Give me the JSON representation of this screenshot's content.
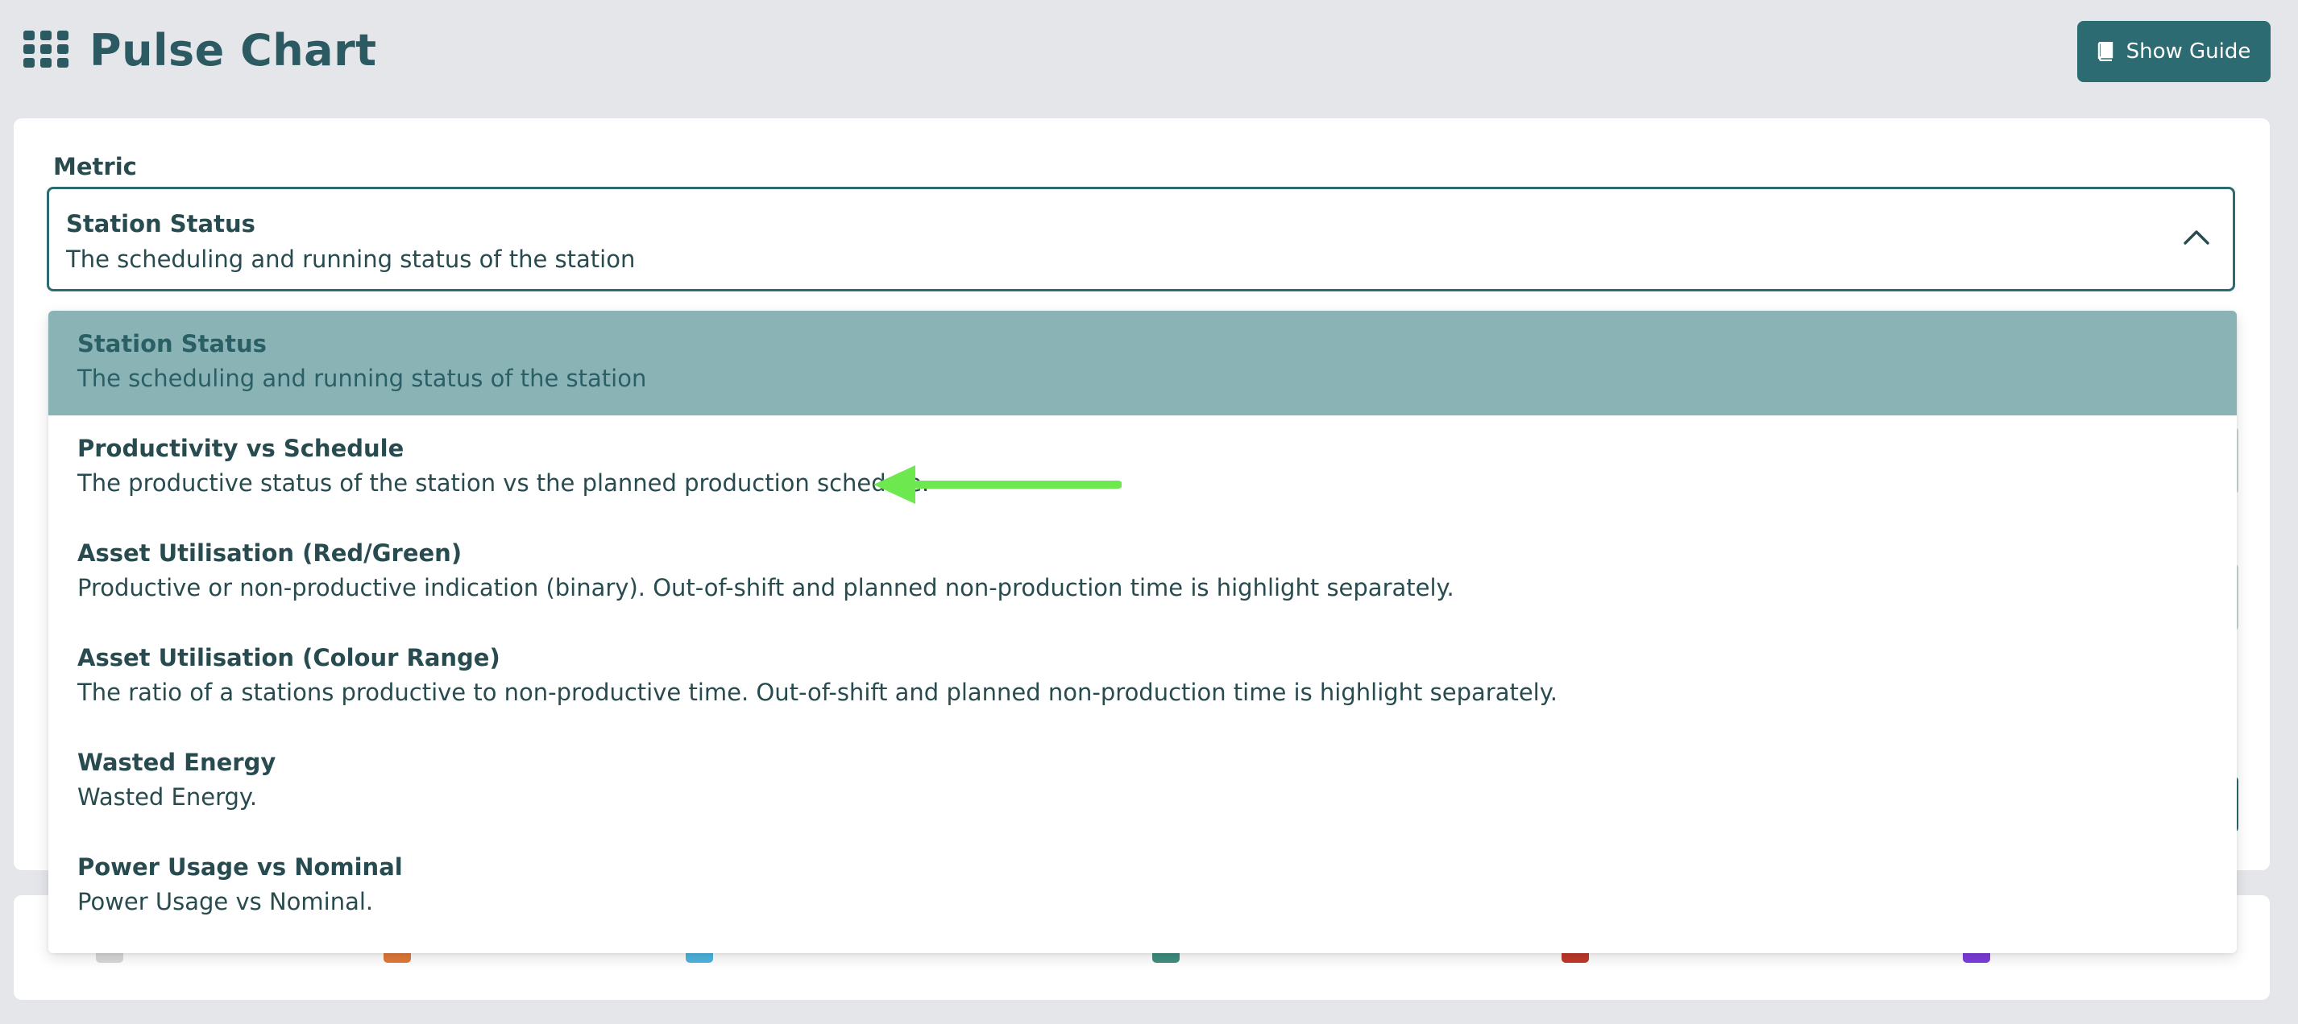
{
  "header": {
    "title": "Pulse Chart",
    "show_guide_label": "Show Guide"
  },
  "icons": {
    "apps": "grid-icon",
    "guide": "book-icon",
    "select_toggle": "chevron-up-icon"
  },
  "metric": {
    "label": "Metric",
    "selected_title": "Station Status",
    "selected_desc": "The scheduling and running status of the station"
  },
  "dropdown": {
    "options": [
      {
        "title": "Station Status",
        "desc": "The scheduling and running status of the station"
      },
      {
        "title": "Productivity vs Schedule",
        "desc": "The productive status of the station vs the planned production schedule."
      },
      {
        "title": "Asset Utilisation (Red/Green)",
        "desc": "Productive or non-productive indication (binary). Out-of-shift and planned non-production time is highlight separately."
      },
      {
        "title": "Asset Utilisation (Colour Range)",
        "desc": "The ratio of a stations productive to non-productive time. Out-of-shift and planned non-production time is highlight separately."
      },
      {
        "title": "Wasted Energy",
        "desc": "Wasted Energy."
      },
      {
        "title": "Power Usage vs Nominal",
        "desc": "Power Usage vs Nominal."
      }
    ]
  },
  "colors": {
    "primary": "#2d6b73",
    "selected_option": "#8ab3b6",
    "text": "#274b4f",
    "background": "#e4e6ea",
    "arrow": "#6de84f",
    "legend": [
      "#d9d9d9",
      "#e07a3a",
      "#4eb5e0",
      "#3f8f7f",
      "#c0392b",
      "#7d3ddc"
    ]
  }
}
